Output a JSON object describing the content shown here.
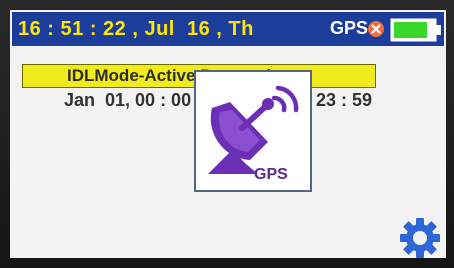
{
  "status_bar": {
    "time_date": "16 : 51 : 22 , Jul  16 , Th",
    "gps_label": "GPS",
    "gps_status": "error",
    "battery_level": 0.85
  },
  "mode_banner": {
    "text": "IDLMode-Active Processing"
  },
  "schedule": {
    "start": "Jan  01, 00 : 00",
    "end": "23 : 59"
  },
  "gps_dialog": {
    "icon": "satellite-dish-icon",
    "label": "GPS"
  },
  "colors": {
    "status_bar_bg": "#1c3d9a",
    "time_text": "#ffe600",
    "banner_bg": "#f1ea1c",
    "gps_error": "#f26d3d",
    "battery": "#39d62b",
    "gear": "#2f66d6",
    "gps_purple": "#6a2fb5"
  }
}
